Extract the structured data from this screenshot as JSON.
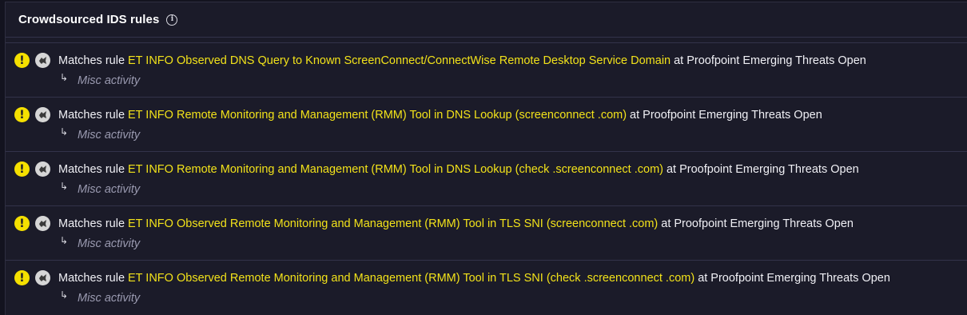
{
  "card": {
    "title": "Crowdsourced IDS rules",
    "info_icon": "info-circle-icon"
  },
  "colors": {
    "rule_highlight": "#f2e21a",
    "severity": "#f5e000",
    "background": "#1b1b29",
    "category_text": "#9a9ab0"
  },
  "rules": [
    {
      "severity_icon": "exclamation-circle-icon",
      "source_icon": "proofpoint-logo-icon",
      "prefix": "Matches rule",
      "name": "ET INFO Observed DNS Query to Known ScreenConnect/ConnectWise Remote Desktop Service Domain",
      "suffix": "at Proofpoint Emerging Threats Open",
      "arrow": "↳",
      "category": "Misc activity"
    },
    {
      "severity_icon": "exclamation-circle-icon",
      "source_icon": "proofpoint-logo-icon",
      "prefix": "Matches rule",
      "name": "ET INFO Remote Monitoring and Management (RMM) Tool in DNS Lookup (screenconnect .com)",
      "suffix": "at Proofpoint Emerging Threats Open",
      "arrow": "↳",
      "category": "Misc activity"
    },
    {
      "severity_icon": "exclamation-circle-icon",
      "source_icon": "proofpoint-logo-icon",
      "prefix": "Matches rule",
      "name": "ET INFO Remote Monitoring and Management (RMM) Tool in DNS Lookup (check .screenconnect .com)",
      "suffix": "at Proofpoint Emerging Threats Open",
      "arrow": "↳",
      "category": "Misc activity"
    },
    {
      "severity_icon": "exclamation-circle-icon",
      "source_icon": "proofpoint-logo-icon",
      "prefix": "Matches rule",
      "name": "ET INFO Observed Remote Monitoring and Management (RMM) Tool in TLS SNI (screenconnect .com)",
      "suffix": "at Proofpoint Emerging Threats Open",
      "arrow": "↳",
      "category": "Misc activity"
    },
    {
      "severity_icon": "exclamation-circle-icon",
      "source_icon": "proofpoint-logo-icon",
      "prefix": "Matches rule",
      "name": "ET INFO Observed Remote Monitoring and Management (RMM) Tool in TLS SNI (check .screenconnect .com)",
      "suffix": "at Proofpoint Emerging Threats Open",
      "arrow": "↳",
      "category": "Misc activity"
    }
  ]
}
